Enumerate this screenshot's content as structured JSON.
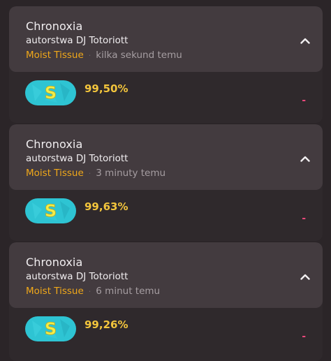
{
  "scores": [
    {
      "song_title": "Chronoxia",
      "artist_line": "autorstwa DJ Totoriott",
      "player_name": "Moist Tissue",
      "separator": "·",
      "time_ago": "kilka sekund temu",
      "rank": "S",
      "accuracy": "99,50%",
      "delta": "-"
    },
    {
      "song_title": "Chronoxia",
      "artist_line": "autorstwa DJ Totoriott",
      "player_name": "Moist Tissue",
      "separator": "·",
      "time_ago": "3 minuty temu",
      "rank": "S",
      "accuracy": "99,63%",
      "delta": "-"
    },
    {
      "song_title": "Chronoxia",
      "artist_line": "autorstwa DJ Totoriott",
      "player_name": "Moist Tissue",
      "separator": "·",
      "time_ago": "6 minut temu",
      "rank": "S",
      "accuracy": "99,26%",
      "delta": "-"
    }
  ],
  "icons": {
    "collapse": "chevron-up-icon",
    "rank": "rank-s-badge-icon"
  },
  "colors": {
    "background": "#2b2528",
    "card_header": "#433b3f",
    "player_name": "#f0a81a",
    "accuracy": "#f3c53c",
    "rank_badge": "#2ec4d3",
    "rank_letter": "#f2ee4a",
    "delta": "#e8487a"
  }
}
